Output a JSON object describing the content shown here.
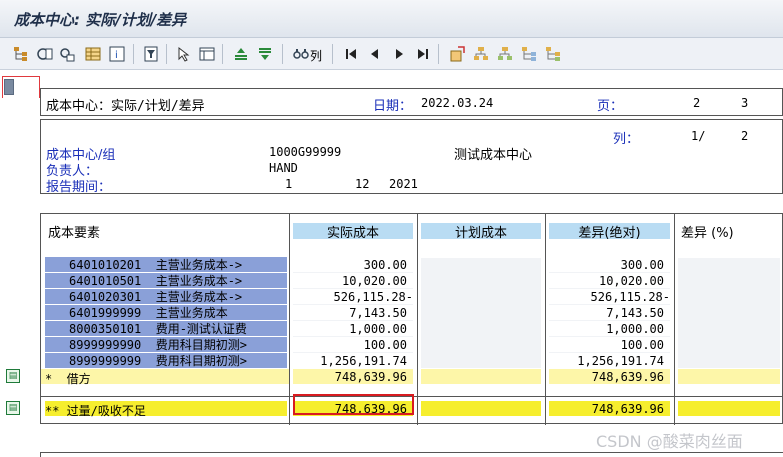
{
  "window": {
    "title": "成本中心: 实际/计划/差异"
  },
  "toolbar": {
    "icons": [
      "hierarchy-icon",
      "drill-icon",
      "search-list-icon",
      "grid-icon",
      "info-icon",
      "filter-icon",
      "pointer-icon",
      "layout-icon",
      "sort-up-icon",
      "sort-down-icon",
      "columns-icon",
      "first-page-icon",
      "prev-page-icon",
      "next-page-icon",
      "last-page-icon",
      "export-icon",
      "tree1-icon",
      "tree2-icon",
      "tree3-icon",
      "tree4-icon"
    ],
    "col_label": "列"
  },
  "report_header": {
    "title": "成本中心：实际/计划/差异",
    "date_label": "日期：",
    "date_value": "2022.03.24",
    "page_label": "页：",
    "page_current": "2",
    "page_total": "3"
  },
  "meta": {
    "col_label": "列：",
    "col_current": "1/",
    "col_total": "2",
    "cc_label": "成本中心/组",
    "cc_value": "1000G99999",
    "cc_desc": "测试成本中心",
    "owner_label": "负责人：",
    "owner_value": "HAND",
    "period_label": "报告期间：",
    "period_from": "1",
    "period_to": "12",
    "period_year": "2021"
  },
  "table": {
    "columns": [
      "成本要素",
      "实际成本",
      "计划成本",
      "差异(绝对)",
      "差异 (%)"
    ],
    "rows": [
      {
        "code": "6401010201",
        "name": "主营业务成本->",
        "actual": "300.00",
        "variance": "300.00"
      },
      {
        "code": "6401010501",
        "name": "主营业务成本->",
        "actual": "10,020.00",
        "variance": "10,020.00"
      },
      {
        "code": "6401020301",
        "name": "主营业务成本->",
        "actual": "526,115.28-",
        "variance": "526,115.28-"
      },
      {
        "code": "6401999999",
        "name": "主营业务成本",
        "actual": "7,143.50",
        "variance": "7,143.50"
      },
      {
        "code": "8000350101",
        "name": "费用-测试认证费",
        "actual": "1,000.00",
        "variance": "1,000.00"
      },
      {
        "code": "8999999990",
        "name": "费用科目期初测>",
        "actual": "100.00",
        "variance": "100.00"
      },
      {
        "code": "8999999999",
        "name": "费用科目期初测>",
        "actual": "1,256,191.74",
        "variance": "1,256,191.74"
      }
    ],
    "debit": {
      "label": "*  借方",
      "actual": "748,639.96",
      "variance": "748,639.96"
    },
    "total": {
      "label": "** 过量/吸收不足",
      "actual": "748,639.96",
      "variance": "748,639.96"
    }
  },
  "watermark": "CSDN @酸菜肉丝面",
  "colors": {
    "header_cell": "#b9dcf3",
    "row_label": "#8aa0d8",
    "debit_row": "#fdf6a8",
    "total_row": "#f6ee2e",
    "highlight_box": "#d81b20"
  }
}
